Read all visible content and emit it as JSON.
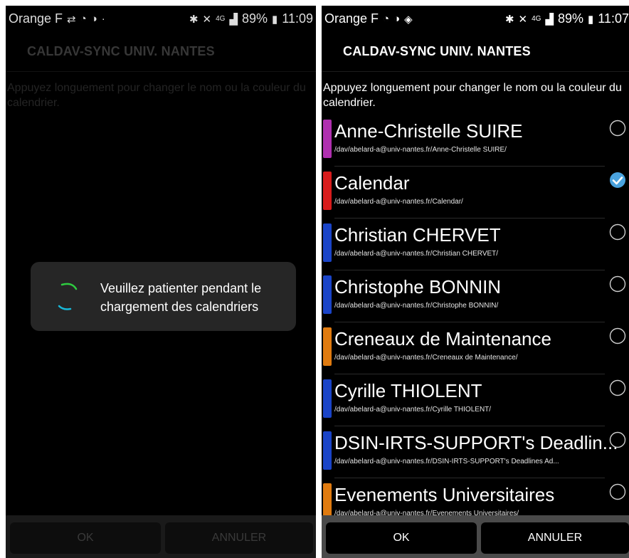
{
  "left_screen": {
    "status": {
      "carrier": "Orange F",
      "battery": "89%",
      "time": "11:09",
      "network": "4G"
    },
    "header": "CALDAV-SYNC UNIV. NANTES",
    "hint": "Appuyez longuement pour changer le nom ou la couleur du calendrier.",
    "dialog_text": "Veuillez patienter pendant le chargement des calendriers",
    "ok_label": "OK",
    "cancel_label": "ANNULER"
  },
  "right_screen": {
    "status": {
      "carrier": "Orange F",
      "battery": "89%",
      "time": "11:07",
      "network": "4G"
    },
    "header": "CALDAV-SYNC UNIV. NANTES",
    "hint": "Appuyez longuement pour changer le nom ou la couleur du calendrier.",
    "ok_label": "OK",
    "cancel_label": "ANNULER",
    "calendars": [
      {
        "name": "Anne-Christelle SUIRE",
        "path": "/dav/abelard-a@univ-nantes.fr/Anne-Christelle SUIRE/",
        "color": "#b030b0",
        "selected": false
      },
      {
        "name": "Calendar",
        "path": "/dav/abelard-a@univ-nantes.fr/Calendar/",
        "color": "#d81c1c",
        "selected": true
      },
      {
        "name": "Christian CHERVET",
        "path": "/dav/abelard-a@univ-nantes.fr/Christian CHERVET/",
        "color": "#1a44c8",
        "selected": false
      },
      {
        "name": "Christophe BONNIN",
        "path": "/dav/abelard-a@univ-nantes.fr/Christophe BONNIN/",
        "color": "#1a44c8",
        "selected": false
      },
      {
        "name": "Creneaux de Maintenance",
        "path": "/dav/abelard-a@univ-nantes.fr/Creneaux de Maintenance/",
        "color": "#e07b10",
        "selected": false
      },
      {
        "name": "Cyrille THIOLENT",
        "path": "/dav/abelard-a@univ-nantes.fr/Cyrille THIOLENT/",
        "color": "#1a44c8",
        "selected": false
      },
      {
        "name": "DSIN-IRTS-SUPPORT's Deadlin...",
        "path": "/dav/abelard-a@univ-nantes.fr/DSIN-IRTS-SUPPORT's Deadlines Ad...",
        "color": "#1a44c8",
        "selected": false
      },
      {
        "name": "Evenements Universitaires",
        "path": "/dav/abelard-a@univ-nantes.fr/Evenements Universitaires/",
        "color": "#e07b10",
        "selected": false
      }
    ]
  },
  "colors": {
    "check_accent": "#4aa3df",
    "spinner_green": "#2ecc40",
    "spinner_cyan": "#18b8d8"
  }
}
